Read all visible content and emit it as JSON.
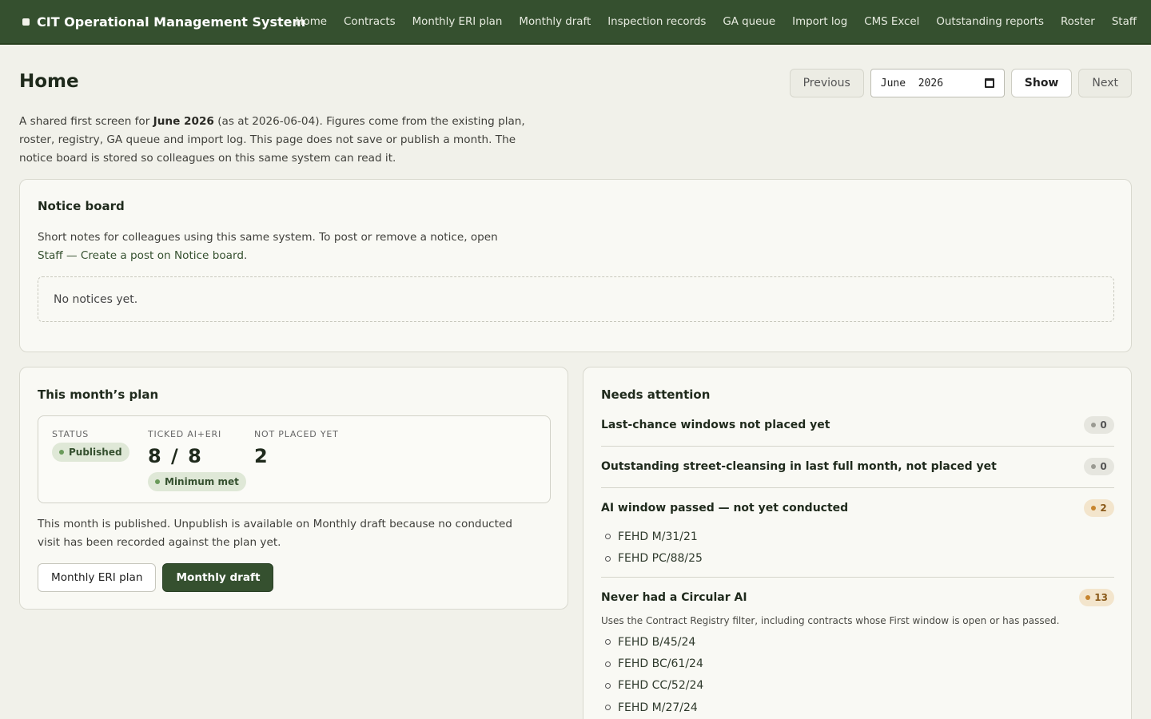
{
  "app": {
    "title": "CIT Operational Management System"
  },
  "nav": [
    {
      "label": "Home"
    },
    {
      "label": "Contracts"
    },
    {
      "label": "Monthly ERI plan"
    },
    {
      "label": "Monthly draft"
    },
    {
      "label": "Inspection records"
    },
    {
      "label": "GA queue"
    },
    {
      "label": "Import log"
    },
    {
      "label": "CMS Excel"
    },
    {
      "label": "Outstanding reports"
    },
    {
      "label": "Roster"
    },
    {
      "label": "Staff"
    }
  ],
  "page": {
    "title": "Home"
  },
  "month_controls": {
    "previous": "Previous",
    "month_value": "June  2026",
    "show": "Show",
    "next": "Next"
  },
  "intro": {
    "p1": "A shared first screen for ",
    "month": "June 2026",
    "p2": " (as at 2026-06-04). Figures come from the existing plan, roster, registry, GA queue and import log. This page does not save or publish a month. The notice board is stored so colleagues on this same system can read it."
  },
  "notice_board": {
    "title": "Notice board",
    "desc_pre": "Short notes for colleagues using this same system. To post or remove a notice, open ",
    "desc_link": "Staff — Create a post on Notice board",
    "desc_post": ".",
    "empty": "No notices yet."
  },
  "plan": {
    "title": "This month’s plan",
    "status_label": "STATUS",
    "status_value": "Published",
    "ticked_label": "TICKED AI+ERI",
    "ticked_value": "8 / 8",
    "minimum_badge": "Minimum met",
    "not_placed_label": "NOT PLACED YET",
    "not_placed_value": "2",
    "note": "This month is published. Unpublish is available on Monthly draft because no conducted visit has been recorded against the plan yet.",
    "btn_eri": "Monthly ERI plan",
    "btn_draft": "Monthly draft"
  },
  "attention": {
    "title": "Needs attention",
    "items": [
      {
        "heading": "Last-chance windows not placed yet",
        "count": "0"
      },
      {
        "heading": "Outstanding street-cleansing in last full month, not placed yet",
        "count": "0"
      },
      {
        "heading": "AI window passed — not yet conducted",
        "count": "2",
        "list": [
          "FEHD M/31/21",
          "FEHD PC/88/25"
        ]
      },
      {
        "heading": "Never had a Circular AI",
        "count": "13",
        "desc": "Uses the Contract Registry filter, including contracts whose First window is open or has passed.",
        "list": [
          "FEHD B/45/24",
          "FEHD BC/61/24",
          "FEHD CC/52/24",
          "FEHD M/27/24"
        ]
      }
    ]
  },
  "colors": {
    "accent": "#35502f",
    "warn": "#c7852e",
    "background": "#f1f1ea"
  }
}
